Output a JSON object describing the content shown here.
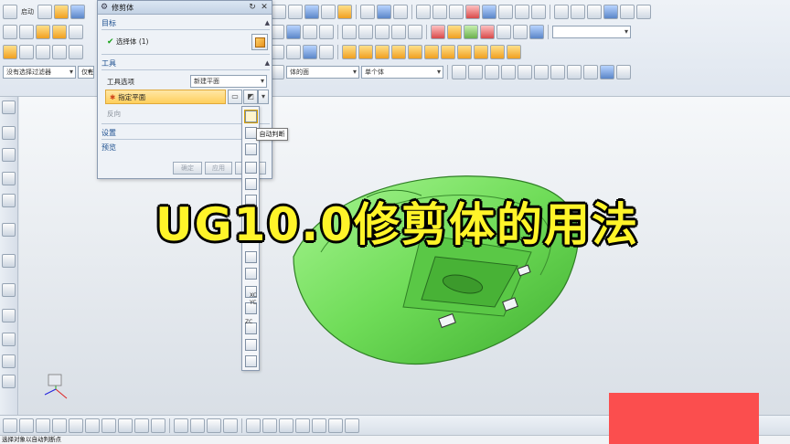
{
  "app": {
    "start_label": "启动",
    "filter_label": "没有选择过滤器",
    "assembly_label": "仅在工",
    "face_combo": "体的面",
    "single_combo": "单个体"
  },
  "dialog": {
    "title": "修剪体",
    "target_section": "目标",
    "select_body": "选择体 (1)",
    "tool_section": "工具",
    "tool_option_label": "工具选项",
    "tool_option_value": "新建平面",
    "specify_plane": "指定平面",
    "reverse_label": "反向",
    "settings_section": "设置",
    "preview_section": "预览",
    "ok_button": "确定",
    "apply_button": "应用",
    "cancel_button": "取消"
  },
  "plane_types": {
    "tooltip": "自动判断",
    "xc": "XC",
    "yc": "YC",
    "zc": "ZC"
  },
  "overlay": {
    "title": "UG10.0修剪体的用法"
  },
  "statusbar": {
    "text": "选择对象以自动判断点"
  },
  "colors": {
    "model": "#7ee86a",
    "overlay_text": "#fff429",
    "red_block": "#fb4e4e"
  }
}
